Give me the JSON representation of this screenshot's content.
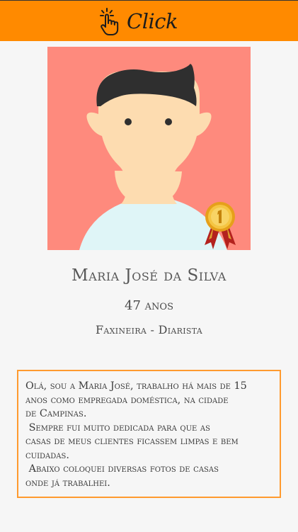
{
  "header": {
    "logo_text": "Click",
    "logo_icon": "tap-hand-icon",
    "background_color": "#ff8a00"
  },
  "profile": {
    "avatar_icon": "user-avatar-illustration",
    "badge_icon": "gold-medal-ribbon-icon",
    "name": "Maria José da Silva",
    "age": "47 anos",
    "occupation": "Faxineira - Diarista"
  },
  "bio": {
    "border_color": "#ff9a2e",
    "lines": [
      "Olá, sou a Maria José, trabalho há mais de 15",
      "anos como empregada doméstica, na cidade",
      "de Campinas.",
      " Sempre fui muito dedicada para que as",
      "casas de meus clientes ficassem limpas e bem",
      "cuidadas.",
      " Abaixo coloquei diversas fotos de casas",
      "onde já trabalhei."
    ]
  }
}
